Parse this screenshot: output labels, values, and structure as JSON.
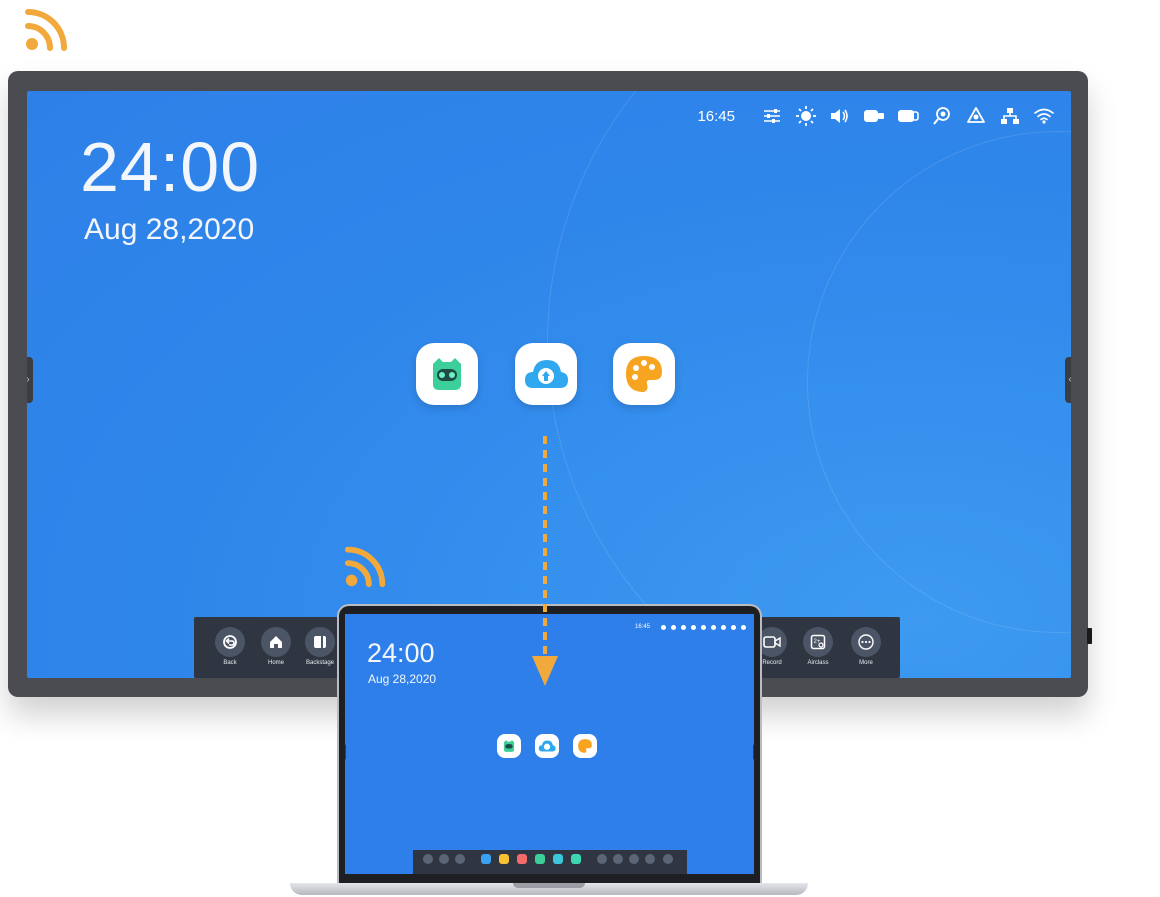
{
  "panel": {
    "clock": {
      "time": "24:00",
      "date": "Aug 28,2020"
    },
    "status_bar": {
      "time": "16:45",
      "icons": [
        "sliders-icon",
        "brightness-icon",
        "volume-icon",
        "camera-icon",
        "toggle-icon",
        "screen-record-icon",
        "eye-icon",
        "network-icon",
        "wifi-icon"
      ]
    },
    "apps": [
      "owl-app-icon",
      "cloud-upload-app-icon",
      "palette-app-icon"
    ],
    "dock": [
      {
        "name": "back",
        "label": "Back"
      },
      {
        "name": "home",
        "label": "Home"
      },
      {
        "name": "backstage",
        "label": "Backstage"
      },
      {
        "name": "record",
        "label": "Record"
      },
      {
        "name": "airclass",
        "label": "Airclass"
      },
      {
        "name": "more",
        "label": "More"
      }
    ]
  },
  "laptop": {
    "clock": {
      "time": "24:00",
      "date": "Aug 28,2020"
    },
    "status_time": "16:45"
  },
  "colors": {
    "accent": "#f2a93b",
    "screen_blue": "#2f86ea",
    "dock_bg": "#2f3642"
  }
}
